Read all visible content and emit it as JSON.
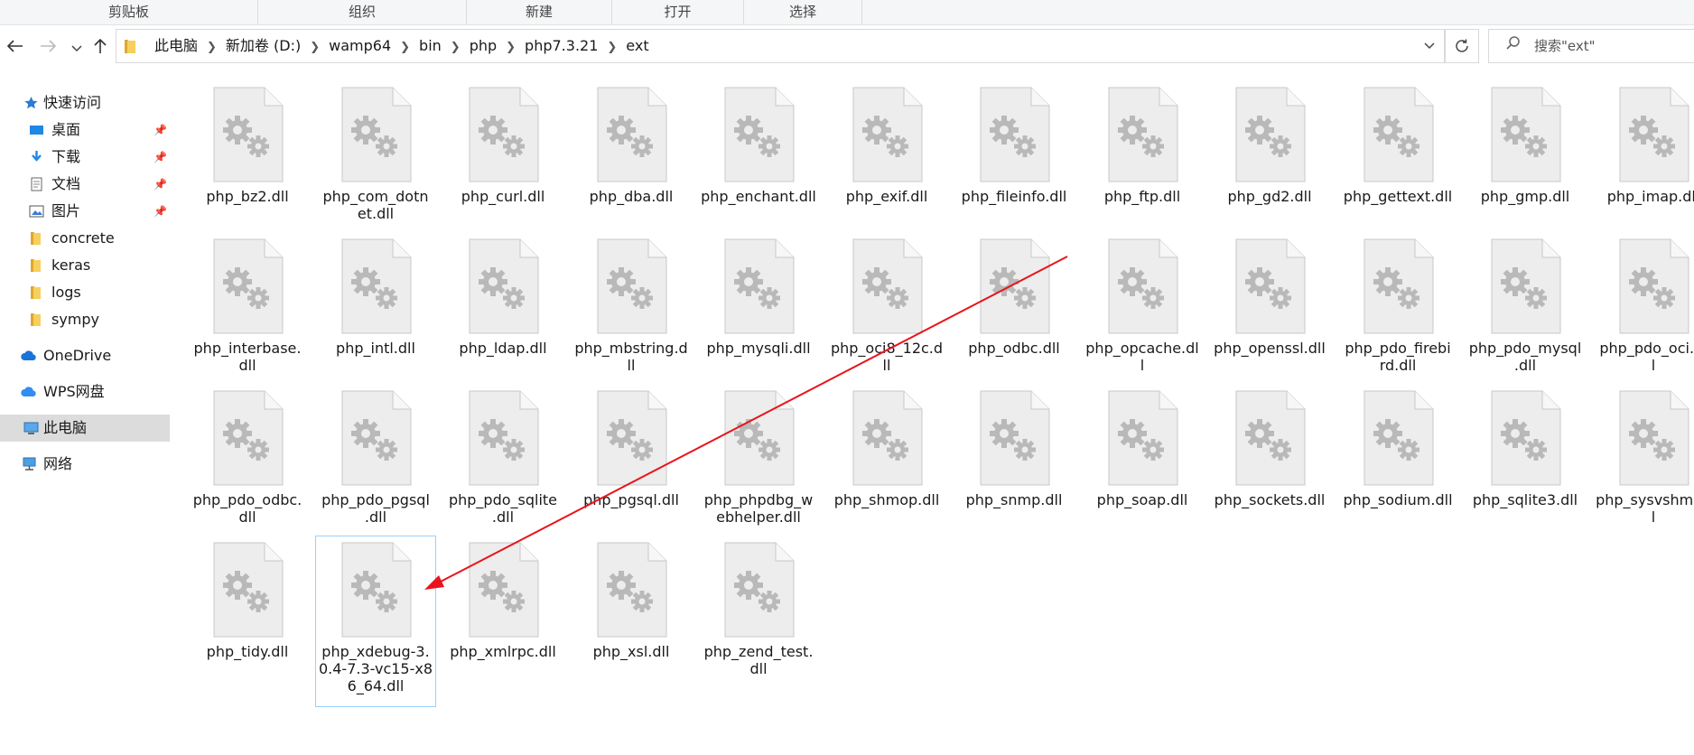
{
  "ribbon": {
    "groups": [
      "剪贴板",
      "组织",
      "新建",
      "打开",
      "选择"
    ]
  },
  "nav": {
    "back_icon": "arrow-left-icon",
    "forward_icon": "arrow-right-icon",
    "recent_icon": "chevron-down-icon",
    "up_icon": "arrow-up-icon",
    "refresh_icon": "refresh-icon"
  },
  "address": {
    "crumbs": [
      "此电脑",
      "新加卷 (D:)",
      "wamp64",
      "bin",
      "php",
      "php7.3.21",
      "ext"
    ]
  },
  "search": {
    "placeholder": "搜索\"ext\""
  },
  "sidebar": {
    "items": [
      {
        "label": "快速访问",
        "icon": "star-icon",
        "pinned": false
      },
      {
        "label": "桌面",
        "icon": "desktop-icon",
        "pinned": true
      },
      {
        "label": "下载",
        "icon": "download-icon",
        "pinned": true
      },
      {
        "label": "文档",
        "icon": "document-icon",
        "pinned": true
      },
      {
        "label": "图片",
        "icon": "picture-icon",
        "pinned": true
      },
      {
        "label": "concrete",
        "icon": "folder-icon",
        "pinned": false
      },
      {
        "label": "keras",
        "icon": "folder-icon",
        "pinned": false
      },
      {
        "label": "logs",
        "icon": "folder-icon",
        "pinned": false
      },
      {
        "label": "sympy",
        "icon": "folder-icon",
        "pinned": false
      },
      {
        "label": "OneDrive",
        "icon": "cloud-icon",
        "pinned": false
      },
      {
        "label": "WPS网盘",
        "icon": "cloud-icon",
        "pinned": false
      },
      {
        "label": "此电脑",
        "icon": "computer-icon",
        "pinned": false,
        "selected": true
      },
      {
        "label": "网络",
        "icon": "network-icon",
        "pinned": false
      }
    ]
  },
  "files": [
    "php_bz2.dll",
    "php_com_dotnet.dll",
    "php_curl.dll",
    "php_dba.dll",
    "php_enchant.dll",
    "php_exif.dll",
    "php_fileinfo.dll",
    "php_ftp.dll",
    "php_gd2.dll",
    "php_gettext.dll",
    "php_gmp.dll",
    "php_imap.dll",
    "php_interbase.dll",
    "php_intl.dll",
    "php_ldap.dll",
    "php_mbstring.dll",
    "php_mysqli.dll",
    "php_oci8_12c.dll",
    "php_odbc.dll",
    "php_opcache.dll",
    "php_openssl.dll",
    "php_pdo_firebird.dll",
    "php_pdo_mysql.dll",
    "php_pdo_oci.dll",
    "php_pdo_odbc.dll",
    "php_pdo_pgsql.dll",
    "php_pdo_sqlite.dll",
    "php_pgsql.dll",
    "php_phpdbg_webhelper.dll",
    "php_shmop.dll",
    "php_snmp.dll",
    "php_soap.dll",
    "php_sockets.dll",
    "php_sodium.dll",
    "php_sqlite3.dll",
    "php_sysvshm.dll",
    "php_tidy.dll",
    "php_xdebug-3.0.4-7.3-vc15-x86_64.dll",
    "php_xmlrpc.dll",
    "php_xsl.dll",
    "php_zend_test.dll"
  ],
  "file_display": [
    "php_bz2.dll",
    "php_com_dotn\net.dll",
    "php_curl.dll",
    "php_dba.dll",
    "php_enchant.dll",
    "php_exif.dll",
    "php_fileinfo.dll",
    "php_ftp.dll",
    "php_gd2.dll",
    "php_gettext.dll",
    "php_gmp.dll",
    "php_imap.dll",
    "php_interbase.\ndll",
    "php_intl.dll",
    "php_ldap.dll",
    "php_mbstring.d\nll",
    "php_mysqli.dll",
    "php_oci8_12c.d\nll",
    "php_odbc.dll",
    "php_opcache.dl\nl",
    "php_openssl.dll",
    "php_pdo_firebi\nrd.dll",
    "php_pdo_mysql\n.dll",
    "php_pdo_oci.dl\nl",
    "php_pdo_odbc.\ndll",
    "php_pdo_pgsql\n.dll",
    "php_pdo_sqlite\n.dll",
    "php_pgsql.dll",
    "php_phpdbg_w\nebhelper.dll",
    "php_shmop.dll",
    "php_snmp.dll",
    "php_soap.dll",
    "php_sockets.dll",
    "php_sodium.dll",
    "php_sqlite3.dll",
    "php_sysvshm.dl\nl",
    "php_tidy.dll",
    "php_xdebug-3.\n0.4-7.3-vc15-x8\n6_64.dll",
    "php_xmlrpc.dll",
    "php_xsl.dll",
    "php_zend_test.\ndll"
  ],
  "selected_file": "php_xdebug-3.0.4-7.3-vc15-x86_64.dll",
  "file_icon": "dll-gear-file-icon",
  "annotation": {
    "type": "arrow",
    "color": "#e8141c",
    "points_to": "php_xdebug-3.0.4-7.3-vc15-x86_64.dll"
  },
  "colors": {
    "accent": "#0078d4",
    "selection_outline": "#99d1ff",
    "folder": "#f2c94c"
  }
}
